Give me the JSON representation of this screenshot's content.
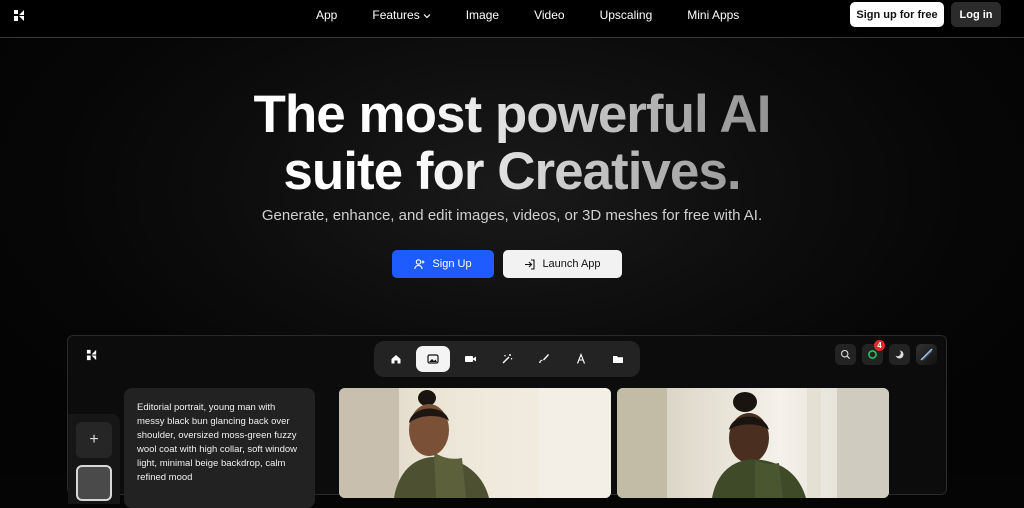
{
  "nav": {
    "links": [
      {
        "label": "App"
      },
      {
        "label": "Features",
        "has_dropdown": true
      },
      {
        "label": "Image"
      },
      {
        "label": "Video"
      },
      {
        "label": "Upscaling"
      },
      {
        "label": "Mini Apps"
      }
    ],
    "signup_label": "Sign up for free",
    "login_label": "Log in"
  },
  "hero": {
    "title_line1": "The most powerful AI",
    "title_line2": "suite for Creatives.",
    "subtitle": "Generate, enhance, and edit images, videos, or 3D meshes for free with AI.",
    "primary_button": "Sign Up",
    "secondary_button": "Launch App"
  },
  "app_preview": {
    "toolbar_tools": [
      "home-icon",
      "image-icon",
      "video-icon",
      "magic-wand-icon",
      "brush-icon",
      "text-icon",
      "folder-icon"
    ],
    "active_tool": "image-icon",
    "right_icons": [
      "search-icon",
      "notifications-icon",
      "moon-icon",
      "avatar"
    ],
    "notification_count": "4",
    "add_label": "+",
    "prompt": "Editorial portrait, young man with messy black bun glancing back over shoulder, oversized moss-green fuzzy wool coat with high collar, soft window light, minimal beige backdrop, calm refined mood"
  },
  "colors": {
    "primary": "#1f5cff",
    "background": "#050505",
    "badge": "#e5262a"
  }
}
